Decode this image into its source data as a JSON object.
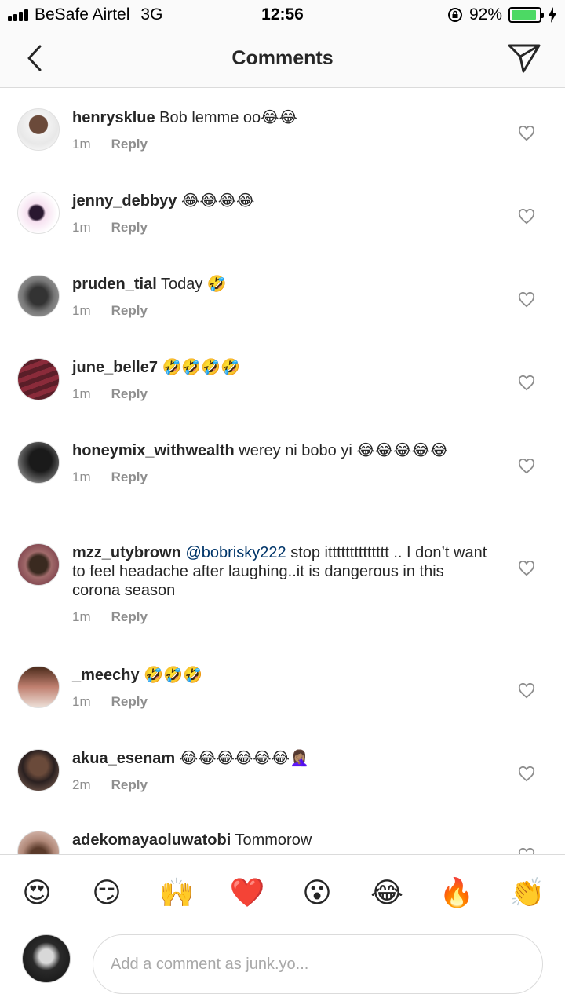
{
  "status_bar": {
    "carrier": "BeSafe Airtel",
    "network": "3G",
    "time": "12:56",
    "battery_percent": "92%",
    "battery_level": 0.92,
    "battery_color": "#4cd964"
  },
  "header": {
    "back_icon": "chevron-left-icon",
    "title": "Comments",
    "share_icon": "paper-plane-icon"
  },
  "comments": [
    {
      "username": "henrysklue",
      "text": "Bob lemme oo😂😂",
      "time": "1m",
      "reply_label": "Reply"
    },
    {
      "username": "jenny_debbyy",
      "text": "😂😂😂😂",
      "time": "1m",
      "reply_label": "Reply"
    },
    {
      "username": "pruden_tial",
      "text": "Today 🤣",
      "time": "1m",
      "reply_label": "Reply"
    },
    {
      "username": "june_belle7",
      "text": "🤣🤣🤣🤣",
      "time": "1m",
      "reply_label": "Reply"
    },
    {
      "username": "honeymix_withwealth",
      "text": "werey ni bobo yi 😂😂😂😂😂",
      "time": "1m",
      "reply_label": "Reply"
    },
    {
      "username": "mzz_utybrown",
      "mention": "@bobrisky222",
      "text": "stop itttttttttttttt .. I don’t want to feel headache after laughing..it is dangerous in this corona season",
      "time": "1m",
      "reply_label": "Reply"
    },
    {
      "username": "_meechy",
      "text": "🤣🤣🤣",
      "time": "1m",
      "reply_label": "Reply"
    },
    {
      "username": "akua_esenam",
      "text": "😂😂😂😂😂😂🤦🏽‍♀️",
      "time": "2m",
      "reply_label": "Reply"
    },
    {
      "username": "adekomayaoluwatobi",
      "text": "Tommorow",
      "time": "",
      "reply_label": ""
    }
  ],
  "emoji_bar": [
    "😍",
    "😏",
    "🙌",
    "❤️",
    "😮",
    "😂",
    "🔥",
    "👏"
  ],
  "input": {
    "placeholder": "Add a comment as junk.yo..."
  },
  "colors": {
    "mention": "#003569",
    "meta": "#8e8e8e",
    "border": "#dbdbdb"
  }
}
